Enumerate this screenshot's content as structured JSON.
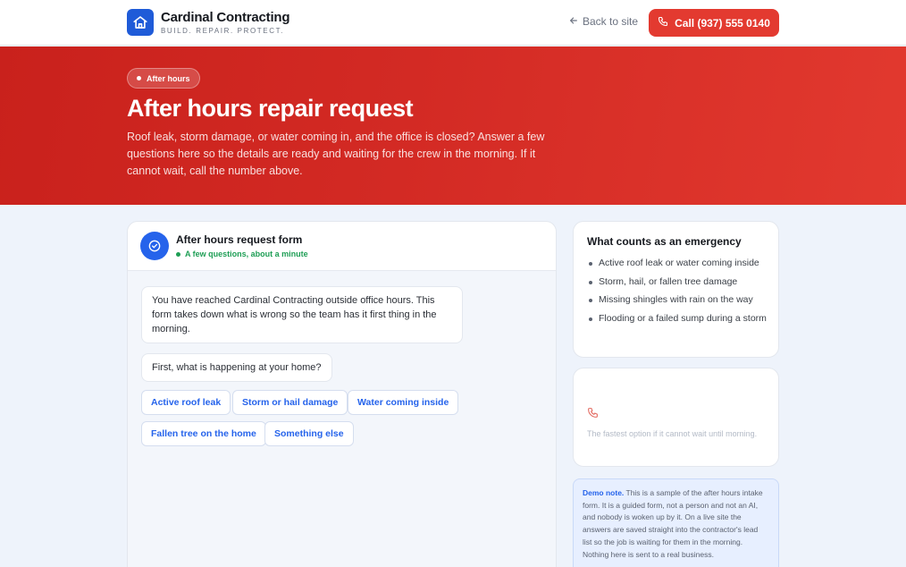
{
  "header": {
    "brand_name": "Cardinal Contracting",
    "brand_tagline": "BUILD. REPAIR. PROTECT.",
    "back_link": "Back to site",
    "call_button": "Call (937) 555 0140"
  },
  "hero": {
    "badge": "After hours",
    "title": "After hours repair request",
    "subtitle": "Roof leak, storm damage, or water coming in, and the office is closed? Answer a few questions here so the details are ready and waiting for the crew in the morning. If it cannot wait, call the number above."
  },
  "form": {
    "title": "After hours request form",
    "status": "A few questions, about a minute",
    "messages": [
      "You have reached Cardinal Contracting outside office hours. This form takes down what is wrong so the team has it first thing in the morning.",
      "First, what is happening at your home?"
    ],
    "options": [
      "Active roof leak",
      "Storm or hail damage",
      "Water coming inside",
      "Fallen tree on the home",
      "Something else"
    ]
  },
  "emergency": {
    "title": "What counts as an emergency",
    "items": [
      "Active roof leak or water coming inside",
      "Storm, hail, or fallen tree damage",
      "Missing shingles with rain on the way",
      "Flooding or a failed sump during a storm"
    ]
  },
  "call_card": {
    "text": "The fastest option if it cannot wait until morning."
  },
  "demo_note": {
    "label": "Demo note.",
    "text": "This is a sample of the after hours intake form. It is a guided form, not a person and not an AI, and nobody is woken up by it. On a live site the answers are saved straight into the contractor's lead list so the job is waiting for them in the morning. Nothing here is sent to a real business."
  },
  "colors": {
    "brand_blue": "#1f5bd8",
    "accent_red": "#e33a30",
    "status_green": "#1e9e55",
    "link_blue": "#2563eb"
  },
  "icons": {
    "brand": "house-icon",
    "back": "arrow-left-icon",
    "call": "phone-icon",
    "form": "check-circle-icon"
  }
}
